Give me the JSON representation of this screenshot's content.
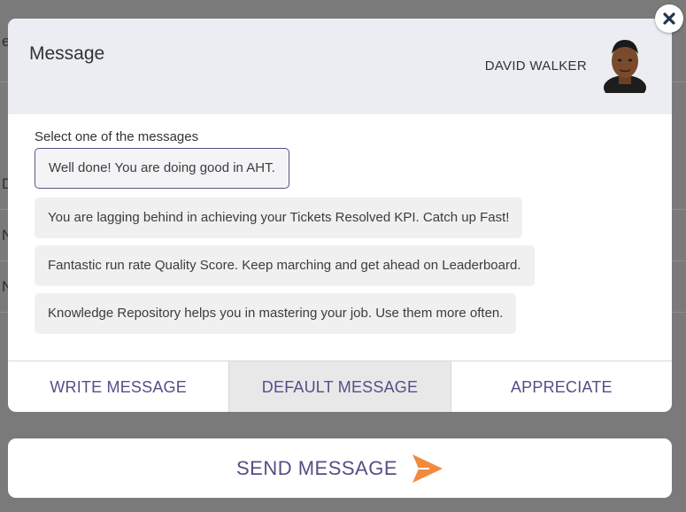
{
  "background": {
    "edge_chars": [
      "e",
      "D",
      "N",
      "N"
    ]
  },
  "modal": {
    "title": "Message",
    "user_name": "DAVID WALKER",
    "prompt": "Select one of the messages",
    "messages": [
      {
        "text": "Well done! You are doing good in AHT.",
        "selected": true
      },
      {
        "text": "You are lagging behind in achieving your Tickets Resolved KPI. Catch up Fast!",
        "selected": false
      },
      {
        "text": "Fantastic run rate Quality Score. Keep marching and get ahead on Leaderboard.",
        "selected": false
      },
      {
        "text": "Knowledge Repository helps you in mastering your job. Use them more often.",
        "selected": false
      }
    ],
    "tabs": [
      {
        "label": "WRITE MESSAGE",
        "active": false
      },
      {
        "label": "DEFAULT MESSAGE",
        "active": true
      },
      {
        "label": "APPRECIATE",
        "active": false
      }
    ]
  },
  "close": {
    "icon": "close-icon"
  },
  "send": {
    "label": "SEND MESSAGE",
    "icon": "send-icon"
  },
  "colors": {
    "accent": "#584d87",
    "send_arrow": "#f28a3d",
    "close_x": "#1f3550",
    "header_bg": "#ebedf2",
    "overlay": "#7a7a7a"
  }
}
